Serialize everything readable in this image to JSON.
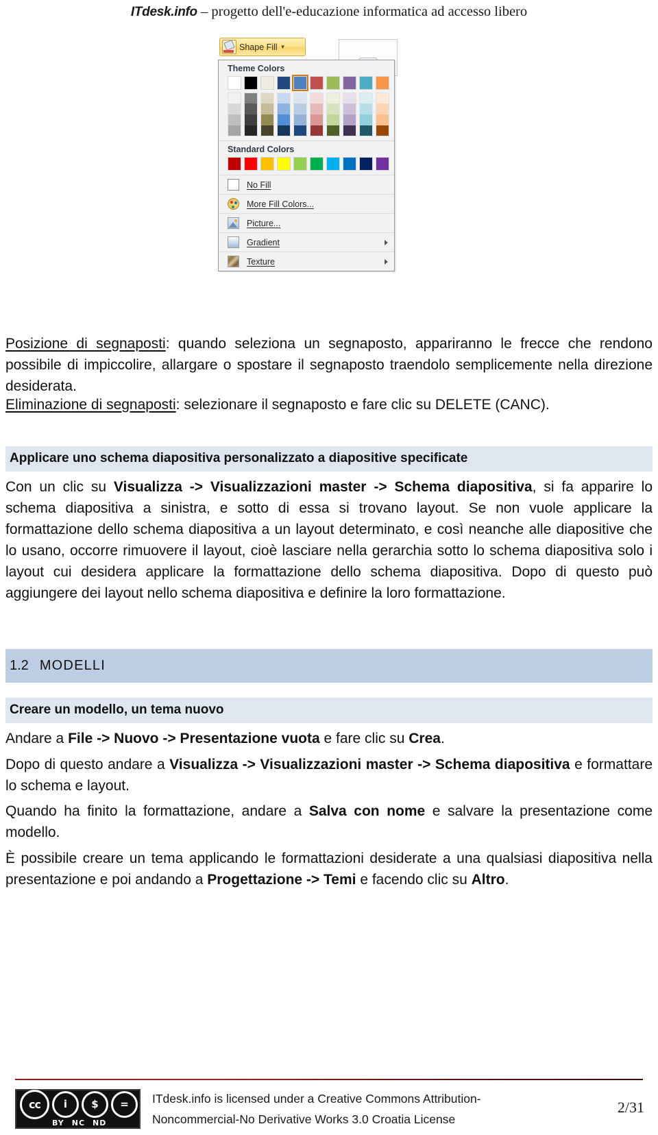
{
  "header": {
    "brand": "ITdesk.info",
    "rest": " – progetto dell'e-educazione informatica ad accesso libero"
  },
  "figure": {
    "name": "powerpoint-shape-fill-dropdown",
    "button_label": "Shape Fill",
    "theme_colors_label": "Theme Colors",
    "standard_colors_label": "Standard Colors",
    "theme_colors_top": [
      "#ffffff",
      "#000000",
      "#eeece1",
      "#1f497d",
      "#4f81bd",
      "#c0504d",
      "#9bbb59",
      "#8064a2",
      "#4bacc6",
      "#f79646"
    ],
    "theme_shades": [
      [
        "#f2f2f2",
        "#d8d8d8",
        "#bfbfbf",
        "#a5a5a5"
      ],
      [
        "#7f7f7f",
        "#595959",
        "#3f3f3f",
        "#262626"
      ],
      [
        "#ddd9c3",
        "#c4bd97",
        "#938953",
        "#494429"
      ],
      [
        "#c6d9f0",
        "#8db3e2",
        "#538dd5",
        "#16365c"
      ],
      [
        "#dbe5f1",
        "#b8cce4",
        "#95b3d7",
        "#1f497d"
      ],
      [
        "#f2dcdb",
        "#e5b9b7",
        "#d99694",
        "#953734"
      ],
      [
        "#ebf1dd",
        "#d7e3bc",
        "#c3d69b",
        "#4f6128"
      ],
      [
        "#e5e0ec",
        "#ccc1d9",
        "#b2a2c7",
        "#3f3151"
      ],
      [
        "#dbeef3",
        "#b7dde8",
        "#92cddc",
        "#205867"
      ],
      [
        "#fdeada",
        "#fbd5b5",
        "#fac08f",
        "#974806"
      ]
    ],
    "selected_swatch_index": 4,
    "selected_swatch_color": "#4f81bd",
    "standard_colors": [
      "#c00000",
      "#ff0000",
      "#ffc000",
      "#ffff00",
      "#92d050",
      "#00b050",
      "#00b0f0",
      "#0070c0",
      "#002060",
      "#7030a0"
    ],
    "menu_items": [
      {
        "label": "No Fill",
        "icon": "no-fill-swatch-icon",
        "submenu": false
      },
      {
        "label": "More Fill Colors...",
        "icon": "palette-icon",
        "submenu": false
      },
      {
        "label": "Picture...",
        "icon": "picture-icon",
        "submenu": false
      },
      {
        "label": "Gradient",
        "icon": "gradient-icon",
        "submenu": true
      },
      {
        "label": "Texture",
        "icon": "texture-icon",
        "submenu": true
      }
    ]
  },
  "content": {
    "p_posizione_lead": "Posizione di segnaposti",
    "p_posizione_rest": ": quando seleziona un segnaposto, appariranno le frecce che rendono possibile di impiccolire, allargare o spostare il segnaposto traendolo semplicemente nella direzione desiderata.",
    "p_eliminazione_lead": "Eliminazione di segnaposti",
    "p_eliminazione_rest": ": selezionare il segnaposto e fare clic su DELETE (CANC).",
    "band_applicare": "Applicare uno schema diapositiva personalizzato a diapositive specificate",
    "p_con_un_clic_1": "Con un clic su ",
    "p_con_un_clic_b": "Visualizza -> Visualizzazioni master -> Schema diapositiva",
    "p_con_un_clic_2": ", si fa apparire lo schema diapositiva a sinistra, e sotto di essa si trovano layout. Se non vuole applicare la formattazione dello schema diapositiva a un layout determinato, e così neanche alle diapositive che lo usano, occorre rimuovere il layout, cioè lasciare nella gerarchia sotto lo schema diapositiva solo i layout cui desidera applicare la formattazione dello schema diapositiva. Dopo di questo può aggiungere dei layout nello schema diapositiva e definire la loro formattazione.",
    "heading_number": "1.2",
    "heading_title": "MODELLI",
    "band_creare": "Creare un modello, un tema nuovo",
    "p_andare_1": "Andare a ",
    "p_andare_b": "File -> Nuovo -> Presentazione vuota",
    "p_andare_2": " e fare clic su ",
    "p_andare_b2": "Crea",
    "p_andare_3": ".",
    "p_dopo_1": "Dopo di questo andare a ",
    "p_dopo_b": "Visualizza -> Visualizzazioni master -> Schema diapositiva",
    "p_dopo_2": " e formattare lo schema e layout.",
    "p_quando_1": "Quando ha finito la formattazione, andare a ",
    "p_quando_b": "Salva con nome",
    "p_quando_2": " e salvare la presentazione come modello.",
    "p_possibile_1": "È possibile creare un tema applicando le formattazioni desiderate a una qualsiasi diapositiva nella presentazione e poi andando a ",
    "p_possibile_b": "Progettazione -> Temi",
    "p_possibile_2": " e facendo clic su ",
    "p_possibile_b2": "Altro",
    "p_possibile_3": "."
  },
  "footer": {
    "license_line1": "ITdesk.info is licensed under a Creative Commons Attribution-",
    "license_line2": "Noncommercial-No Derivative Works 3.0 Croatia License",
    "page_number": "2/31",
    "cc_mark": "cc",
    "cc_badges": [
      "BY",
      "NC",
      "ND"
    ],
    "cc_glyphs": [
      "ℹ",
      "Ⓢ",
      "="
    ]
  }
}
